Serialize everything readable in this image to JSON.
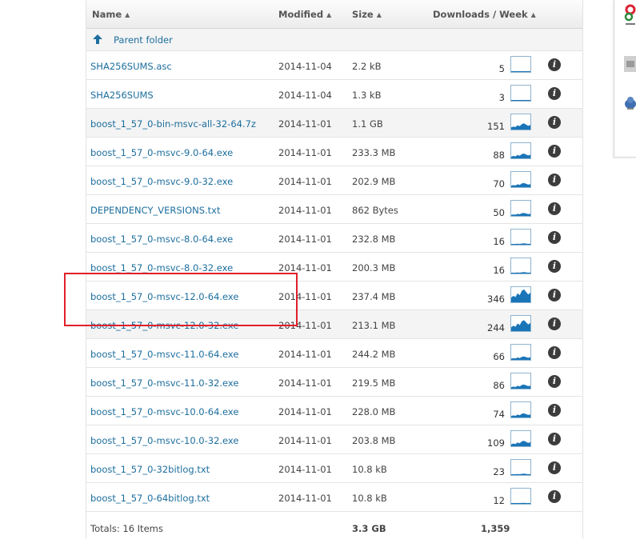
{
  "header": {
    "name_label": "Name",
    "modified_label": "Modified",
    "size_label": "Size",
    "downloads_label": "Downloads / Week"
  },
  "parent_folder": {
    "label": "Parent folder"
  },
  "files": [
    {
      "name": "SHA256SUMS.asc",
      "modified": "2014-11-04",
      "size": "2.2 kB",
      "downloads": "5",
      "level": 0.05
    },
    {
      "name": "SHA256SUMS",
      "modified": "2014-11-04",
      "size": "1.3 kB",
      "downloads": "3",
      "level": 0.04
    },
    {
      "name": "boost_1_57_0-bin-msvc-all-32-64.7z",
      "modified": "2014-11-01",
      "size": "1.1 GB",
      "downloads": "151",
      "level": 0.45
    },
    {
      "name": "boost_1_57_0-msvc-9.0-64.exe",
      "modified": "2014-11-01",
      "size": "233.3 MB",
      "downloads": "88",
      "level": 0.35
    },
    {
      "name": "boost_1_57_0-msvc-9.0-32.exe",
      "modified": "2014-11-01",
      "size": "202.9 MB",
      "downloads": "70",
      "level": 0.3
    },
    {
      "name": "DEPENDENCY_VERSIONS.txt",
      "modified": "2014-11-01",
      "size": "862 Bytes",
      "downloads": "50",
      "level": 0.22
    },
    {
      "name": "boost_1_57_0-msvc-8.0-64.exe",
      "modified": "2014-11-01",
      "size": "232.8 MB",
      "downloads": "16",
      "level": 0.1
    },
    {
      "name": "boost_1_57_0-msvc-8.0-32.exe",
      "modified": "2014-11-01",
      "size": "200.3 MB",
      "downloads": "16",
      "level": 0.1
    },
    {
      "name": "boost_1_57_0-msvc-12.0-64.exe",
      "modified": "2014-11-01",
      "size": "237.4 MB",
      "downloads": "346",
      "level": 0.95
    },
    {
      "name": "boost_1_57_0-msvc-12.0-32.exe",
      "modified": "2014-11-01",
      "size": "213.1 MB",
      "downloads": "244",
      "level": 0.8
    },
    {
      "name": "boost_1_57_0-msvc-11.0-64.exe",
      "modified": "2014-11-01",
      "size": "244.2 MB",
      "downloads": "66",
      "level": 0.25
    },
    {
      "name": "boost_1_57_0-msvc-11.0-32.exe",
      "modified": "2014-11-01",
      "size": "219.5 MB",
      "downloads": "86",
      "level": 0.3
    },
    {
      "name": "boost_1_57_0-msvc-10.0-64.exe",
      "modified": "2014-11-01",
      "size": "228.0 MB",
      "downloads": "74",
      "level": 0.3
    },
    {
      "name": "boost_1_57_0-msvc-10.0-32.exe",
      "modified": "2014-11-01",
      "size": "203.8 MB",
      "downloads": "109",
      "level": 0.4
    },
    {
      "name": "boost_1_57_0-32bitlog.txt",
      "modified": "2014-11-01",
      "size": "10.8 kB",
      "downloads": "23",
      "level": 0.1
    },
    {
      "name": "boost_1_57_0-64bitlog.txt",
      "modified": "2014-11-01",
      "size": "10.8 kB",
      "downloads": "12",
      "level": 0.07
    }
  ],
  "totals": {
    "label": "Totals: 16 Items",
    "size": "3.3 GB",
    "downloads": "1,359"
  },
  "colors": {
    "link": "#1d6e9e",
    "sparkline": "#1a75b8",
    "highlight": "#e0202a"
  },
  "icons": {
    "sort": "sort-icon",
    "parent": "arrow-up-icon",
    "info": "info-icon"
  }
}
